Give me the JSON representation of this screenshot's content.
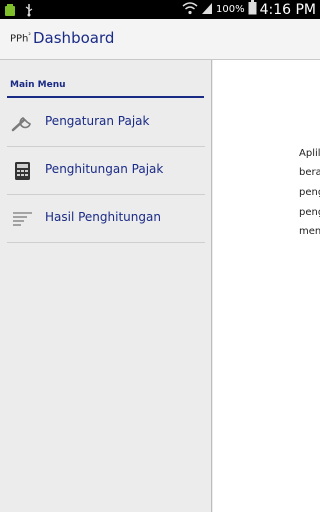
{
  "status_bar": {
    "battery_percent": "100%",
    "time": "4:16 PM",
    "icons": [
      "app-notification-icon",
      "usb-icon",
      "wifi-icon",
      "signal-icon",
      "battery-icon"
    ]
  },
  "action_bar": {
    "logo_main": "PPh",
    "logo_sup": "²",
    "title": "Dashboard"
  },
  "drawer": {
    "header": "Main Menu",
    "items": [
      {
        "label": "Pengaturan Pajak",
        "icon": "wrench-icon"
      },
      {
        "label": "Penghitungan Pajak",
        "icon": "calculator-icon"
      },
      {
        "label": "Hasil Penghitungan",
        "icon": "list-lines-icon"
      }
    ]
  },
  "content": {
    "lines": [
      "Aplil",
      "bera",
      "peng",
      "peng",
      "men"
    ]
  },
  "colors": {
    "accent": "#1a2b86",
    "background": "#ececec",
    "content_bg": "#ffffff"
  }
}
